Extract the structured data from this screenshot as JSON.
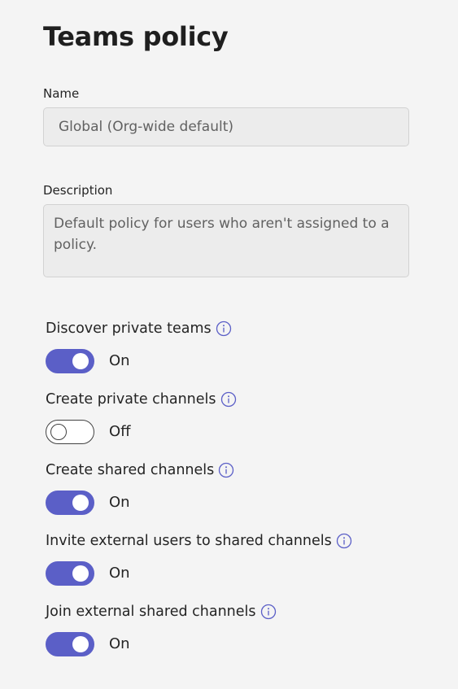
{
  "page": {
    "title": "Teams policy"
  },
  "name_field": {
    "label": "Name",
    "value": "Global (Org-wide default)"
  },
  "description_field": {
    "label": "Description",
    "value": "Default policy for users who aren't assigned to a policy."
  },
  "settings": [
    {
      "label": "Discover private teams",
      "state": "On",
      "enabled": true,
      "icon": "info-icon"
    },
    {
      "label": "Create private channels",
      "state": "Off",
      "enabled": false,
      "icon": "info-icon"
    },
    {
      "label": "Create shared channels",
      "state": "On",
      "enabled": true,
      "icon": "info-icon"
    },
    {
      "label": "Invite external users to shared channels",
      "state": "On",
      "enabled": true,
      "icon": "info-icon"
    },
    {
      "label": "Join external shared channels",
      "state": "On",
      "enabled": true,
      "icon": "info-icon"
    }
  ],
  "colors": {
    "accent": "#5b5fc7",
    "background": "#f4f4f4",
    "field_background": "#ececec"
  }
}
